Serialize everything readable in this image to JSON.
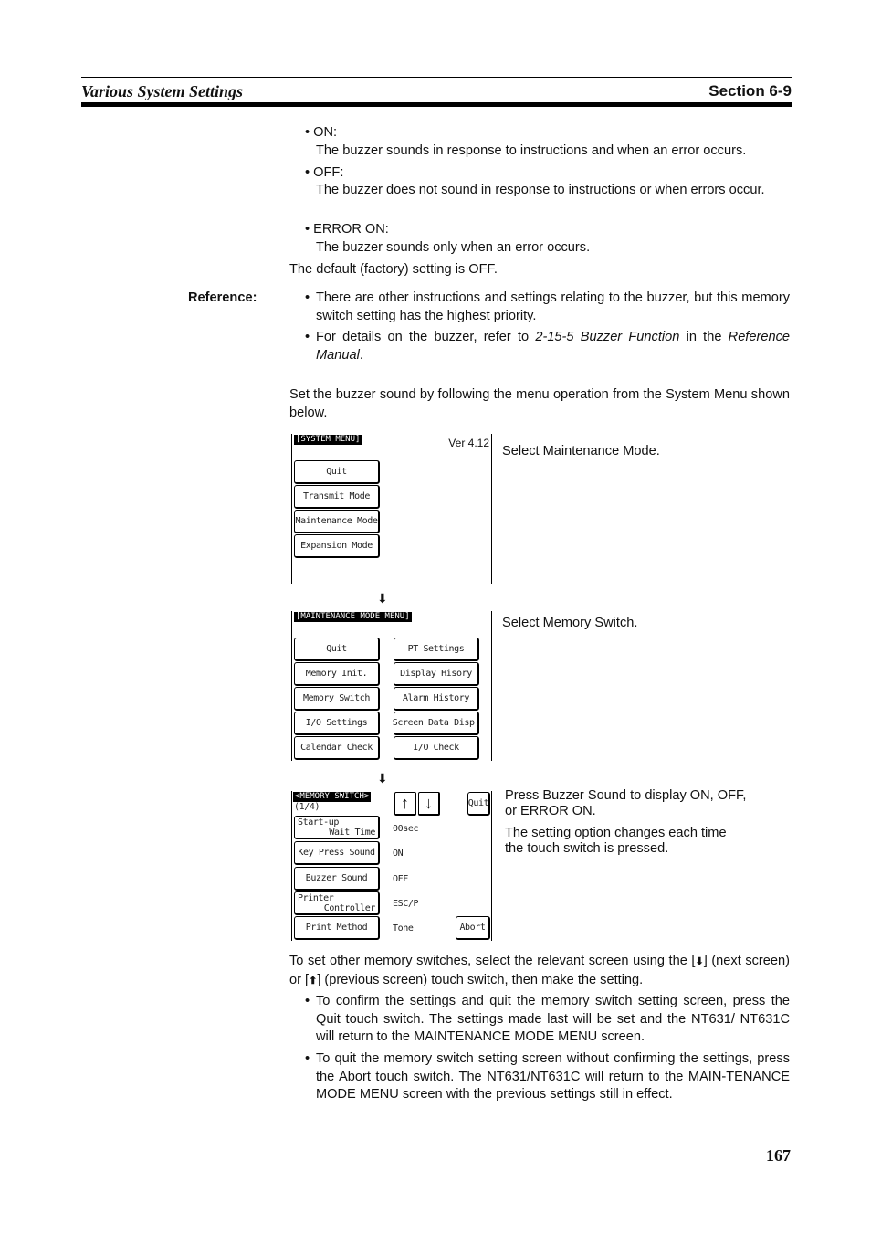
{
  "header": {
    "left_title": "Various System Settings",
    "right_title": "Section 6-9"
  },
  "options": [
    {
      "label": "• ON:",
      "desc": "The buzzer sounds in response to instructions and when an error occurs."
    },
    {
      "label": "• OFF:",
      "desc": "The buzzer does not sound in response to instructions or when errors occur."
    },
    {
      "label": "• ERROR ON:",
      "desc": "The buzzer sounds only when an error occurs."
    }
  ],
  "default_setting": "The default (factory) setting is OFF.",
  "reference": {
    "label": "Reference:",
    "bullet1": "There are other instructions and settings relating to the buzzer, but this memory switch setting has the highest priority.",
    "bullet2_pre": "For details on the buzzer, refer to ",
    "bullet2_ital1": "2-15-5 Buzzer Function",
    "bullet2_mid": " in the ",
    "bullet2_ital2": "Reference Manual",
    "bullet2_post": "."
  },
  "intro": "Set the buzzer sound by following the menu operation from the System Menu shown below.",
  "system_menu": {
    "title": "[SYSTEM MENU]",
    "version": "Ver 4.12",
    "buttons": [
      "Quit",
      "Transmit Mode",
      "Maintenance Mode",
      "Expansion Mode"
    ],
    "caption": "Select Maintenance Mode."
  },
  "maintenance_menu": {
    "title": "[MAINTENANCE MODE MENU]",
    "left_buttons": [
      "Quit",
      "Memory Init.",
      "Memory Switch",
      "I/O Settings",
      "Calendar Check"
    ],
    "right_buttons": [
      "PT Settings",
      "Display Hisory",
      "Alarm History",
      "Screen Data Disp.",
      "I/O Check"
    ],
    "caption": "Select Memory Switch."
  },
  "memory_switch": {
    "title": "<MEMORY SWITCH>",
    "page": "(1/4)",
    "up_icon": "↑",
    "down_icon": "↓",
    "quit": "Quit",
    "abort": "Abort",
    "rows": [
      {
        "label1": "Start-up",
        "label2": "Wait Time",
        "value": "00sec"
      },
      {
        "label1": "Key Press Sound",
        "label2": "",
        "value": "ON"
      },
      {
        "label1": "Buzzer Sound",
        "label2": "",
        "value": "OFF"
      },
      {
        "label1": "Printer",
        "label2": "Controller",
        "value": "ESC/P"
      },
      {
        "label1": "Print Method",
        "label2": "",
        "value": "Tone"
      }
    ],
    "caption1": "Press Buzzer Sound to display ON, OFF, or ERROR ON.",
    "caption2": "The setting option changes each time the touch switch is pressed."
  },
  "flow_arrow": "⬇",
  "closing": {
    "p1_a": "To set other memory switches, select the relevant screen using the [",
    "p1_down": "⬇",
    "p1_b": "] (next screen) or [",
    "p1_up": "⬆",
    "p1_c": "] (previous screen) touch switch, then make the setting.",
    "bullet1": "To confirm the settings and quit the memory switch setting screen, press the Quit touch switch. The settings made last will be set and the NT631/ NT631C will return to the MAINTENANCE MODE MENU screen.",
    "bullet2": "To quit the memory switch setting screen without confirming the settings, press the Abort touch switch. The NT631/NT631C will return to the MAIN-TENANCE MODE MENU screen with the previous settings still in effect."
  },
  "page_number": "167"
}
